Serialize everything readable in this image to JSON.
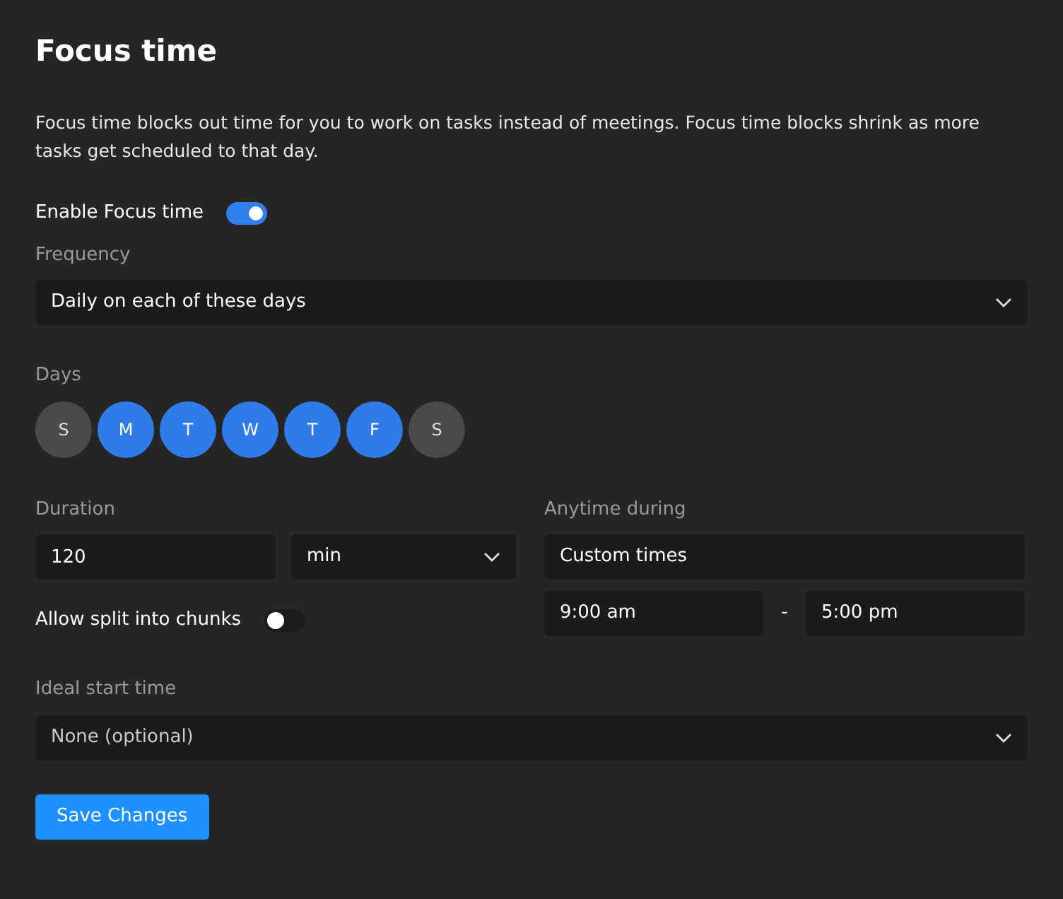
{
  "title": "Focus time",
  "description": "Focus time blocks out time for you to work on tasks instead of meetings. Focus time blocks shrink as more tasks get scheduled to that day.",
  "enable_toggle": {
    "label": "Enable Focus time",
    "on": true
  },
  "frequency": {
    "label": "Frequency",
    "value": "Daily on each of these days"
  },
  "days": {
    "label": "Days",
    "items": [
      {
        "label": "S",
        "selected": false
      },
      {
        "label": "M",
        "selected": true
      },
      {
        "label": "T",
        "selected": true
      },
      {
        "label": "W",
        "selected": true
      },
      {
        "label": "T",
        "selected": true
      },
      {
        "label": "F",
        "selected": true
      },
      {
        "label": "S",
        "selected": false
      }
    ]
  },
  "duration": {
    "label": "Duration",
    "value": "120",
    "unit": "min"
  },
  "split_toggle": {
    "label": "Allow split into chunks",
    "on": false
  },
  "anytime": {
    "label": "Anytime during",
    "value": "Custom times",
    "start": "9:00 am",
    "separator": "-",
    "end": "5:00 pm"
  },
  "ideal_start": {
    "label": "Ideal start time",
    "value": "None (optional)"
  },
  "save_button": "Save Changes"
}
